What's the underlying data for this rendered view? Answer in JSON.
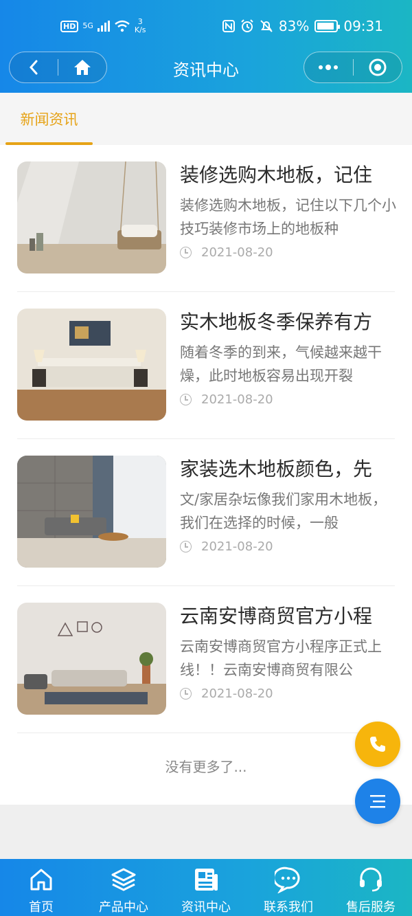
{
  "status_bar": {
    "hd": "HD",
    "network": "5G",
    "speed_value": "3",
    "speed_unit": "K/s",
    "battery": "83%",
    "time": "09:31"
  },
  "header": {
    "title": "资讯中心"
  },
  "tabs": [
    {
      "label": "新闻资讯",
      "active": true
    }
  ],
  "articles": [
    {
      "title": "装修选购木地板，记住",
      "summary": "装修选购木地板，记住以下几个小技巧装修市场上的地板种",
      "date": "2021-08-20"
    },
    {
      "title": "实木地板冬季保养有方",
      "summary": "随着冬季的到来，气候越来越干燥，此时地板容易出现开裂",
      "date": "2021-08-20"
    },
    {
      "title": "家装选木地板颜色，先",
      "summary": "文/家居杂坛像我们家用木地板，我们在选择的时候，一般",
      "date": "2021-08-20"
    },
    {
      "title": "云南安博商贸官方小程",
      "summary": "云南安博商贸官方小程序正式上线！！云南安博商贸有限公",
      "date": "2021-08-20"
    }
  ],
  "list_end_text": "没有更多了...",
  "bottom_nav": [
    {
      "label": "首页",
      "icon": "home-icon"
    },
    {
      "label": "产品中心",
      "icon": "layers-icon"
    },
    {
      "label": "资讯中心",
      "icon": "news-icon"
    },
    {
      "label": "联系我们",
      "icon": "chat-icon"
    },
    {
      "label": "售后服务",
      "icon": "headset-icon"
    }
  ],
  "colors": {
    "brand_start": "#1687e8",
    "brand_end": "#1bb6c4",
    "accent": "#e6a317",
    "fab_phone": "#f7b50c",
    "fab_menu": "#1e82e8"
  }
}
